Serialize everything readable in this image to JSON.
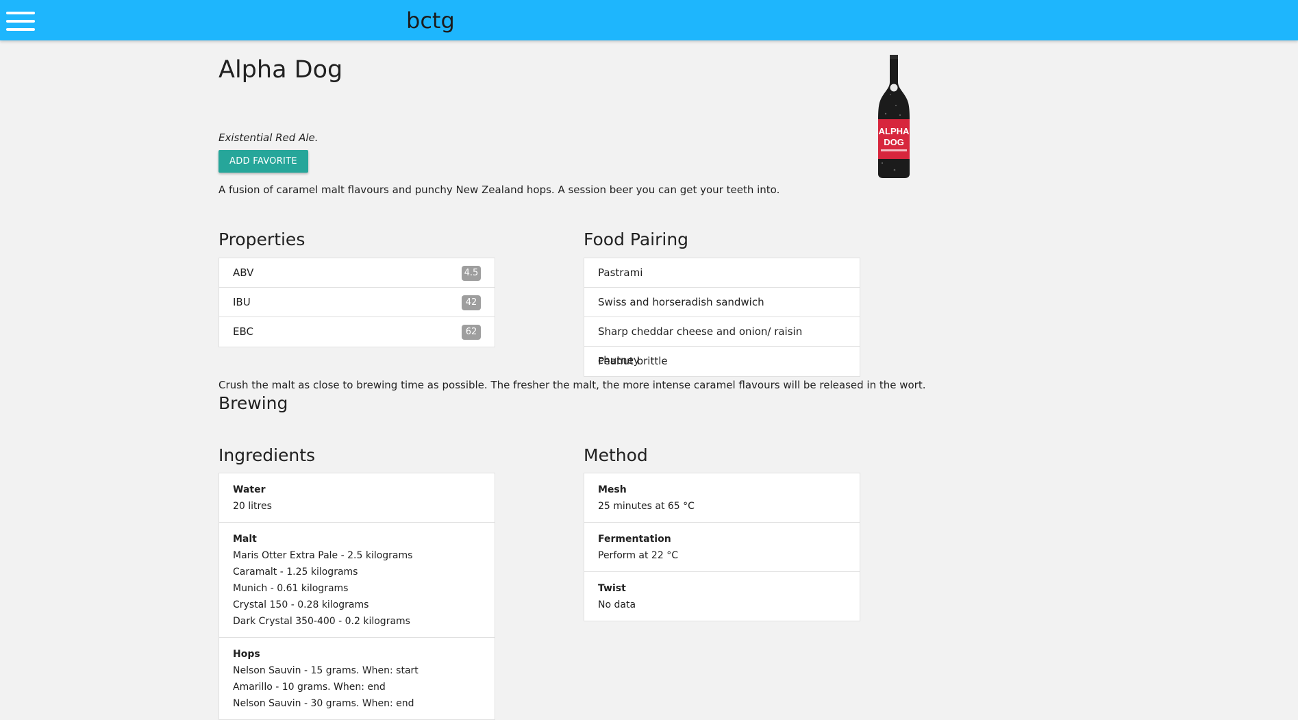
{
  "navbar": {
    "brand": "bctg",
    "menu_icon": "hamburger-menu-icon"
  },
  "beer": {
    "name": "Alpha Dog",
    "tagline": "Existential Red Ale.",
    "favorite_button": "ADD FAVORITE",
    "description": "A fusion of caramel malt flavours and punchy New Zealand hops. A session beer you can get your teeth into.",
    "bottle_label": [
      "ALPHA",
      "DOG"
    ]
  },
  "properties": {
    "title": "Properties",
    "items": [
      {
        "label": "ABV",
        "value": "4.5"
      },
      {
        "label": "IBU",
        "value": "42"
      },
      {
        "label": "EBC",
        "value": "62"
      }
    ]
  },
  "food_pairing": {
    "title": "Food Pairing",
    "items": [
      "Pastrami",
      "Swiss and horseradish sandwich",
      "Sharp cheddar cheese and onion/ raisin chutney",
      "Peanut brittle"
    ]
  },
  "brewing": {
    "title": "Brewing",
    "text": "Crush the malt as close to brewing time as possible. The fresher the malt, the more intense caramel flavours will be released in the wort."
  },
  "ingredients": {
    "title": "Ingredients",
    "water": {
      "title": "Water",
      "lines": [
        "20 litres"
      ]
    },
    "malt": {
      "title": "Malt",
      "lines": [
        "Maris Otter Extra Pale - 2.5 kilograms",
        "Caramalt - 1.25 kilograms",
        "Munich - 0.61 kilograms",
        "Crystal 150 - 0.28 kilograms",
        "Dark Crystal 350-400 - 0.2 kilograms"
      ]
    },
    "hops": {
      "title": "Hops",
      "lines": [
        "Nelson Sauvin - 15 grams. When: start",
        "Amarillo - 10 grams. When: end",
        "Nelson Sauvin - 30 grams. When: end"
      ]
    }
  },
  "method": {
    "title": "Method",
    "mesh": {
      "title": "Mesh",
      "lines": [
        "25 minutes at 65 °C"
      ]
    },
    "fermentation": {
      "title": "Fermentation",
      "lines": [
        "Perform at 22 °C"
      ]
    },
    "twist": {
      "title": "Twist",
      "lines": [
        "No data"
      ]
    }
  },
  "colors": {
    "navbar": "#1eb6fd",
    "button": "#26a69a",
    "badge": "#9e9e9e",
    "bottle_label": "#d7263d"
  }
}
